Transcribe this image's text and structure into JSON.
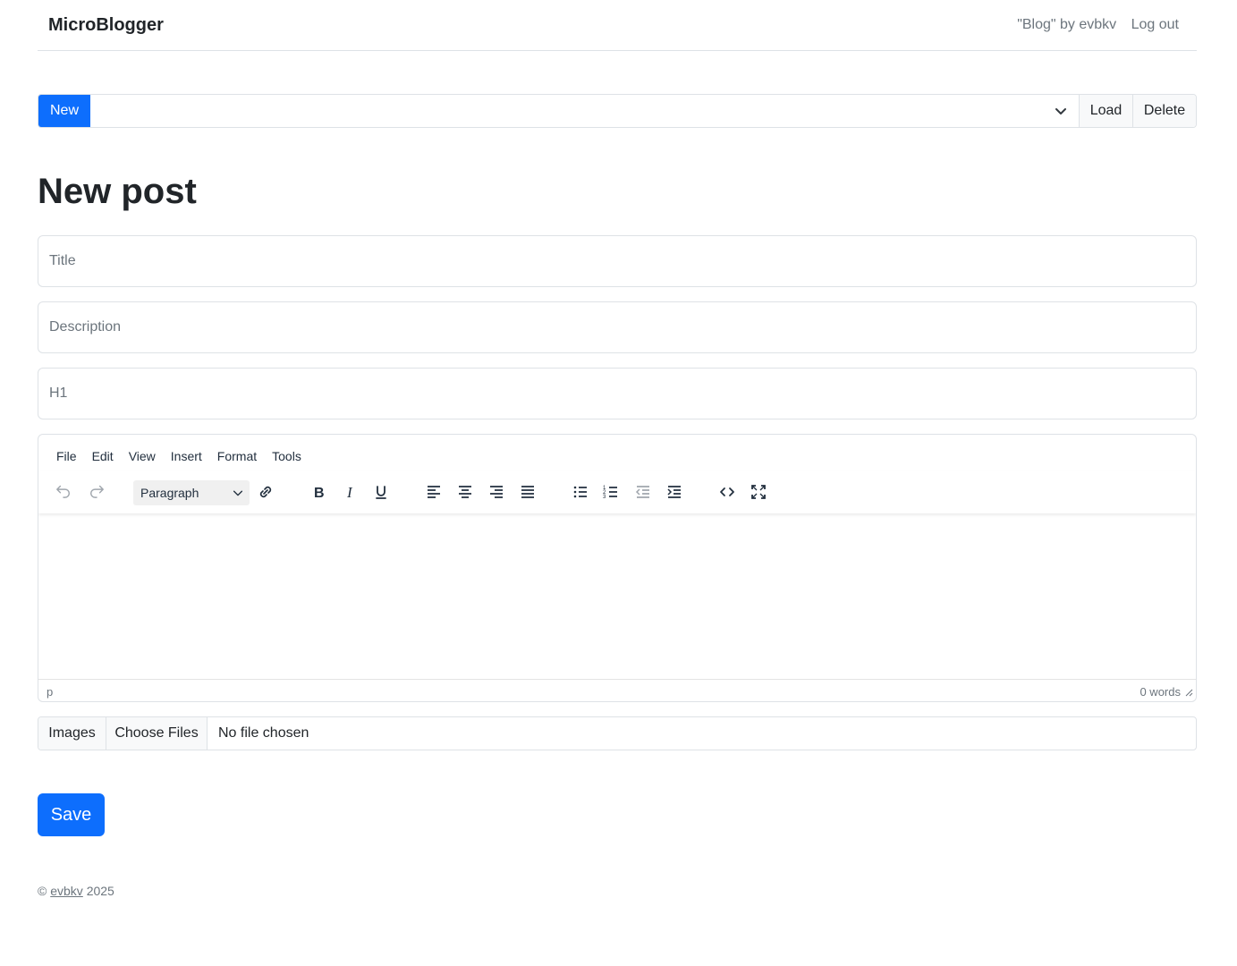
{
  "nav": {
    "brand": "MicroBlogger",
    "blog_link": "\"Blog\" by evbkv",
    "logout": "Log out"
  },
  "post_bar": {
    "new_label": "New",
    "selected_post": "",
    "load_label": "Load",
    "delete_label": "Delete"
  },
  "page_title": "New post",
  "form": {
    "title_placeholder": "Title",
    "description_placeholder": "Description",
    "h1_placeholder": "H1"
  },
  "editor": {
    "menu": [
      "File",
      "Edit",
      "View",
      "Insert",
      "Format",
      "Tools"
    ],
    "block_format": "Paragraph",
    "toolbar_icons": [
      "undo-icon",
      "redo-icon",
      "link-icon",
      "bold-icon",
      "italic-icon",
      "underline-icon",
      "align-left-icon",
      "align-center-icon",
      "align-right-icon",
      "align-justify-icon",
      "bullet-list-icon",
      "numbered-list-icon",
      "outdent-icon",
      "indent-icon",
      "source-code-icon",
      "fullscreen-icon"
    ],
    "status_path": "p",
    "word_count": "0 words"
  },
  "images": {
    "label": "Images",
    "choose_button": "Choose Files",
    "status": "No file chosen"
  },
  "save_label": "Save",
  "footer": {
    "copyright": "©",
    "author": "evbkv",
    "year": "2025"
  },
  "colors": {
    "primary": "#0d6efd",
    "border": "#dee2e6",
    "muted": "#6c757d"
  }
}
